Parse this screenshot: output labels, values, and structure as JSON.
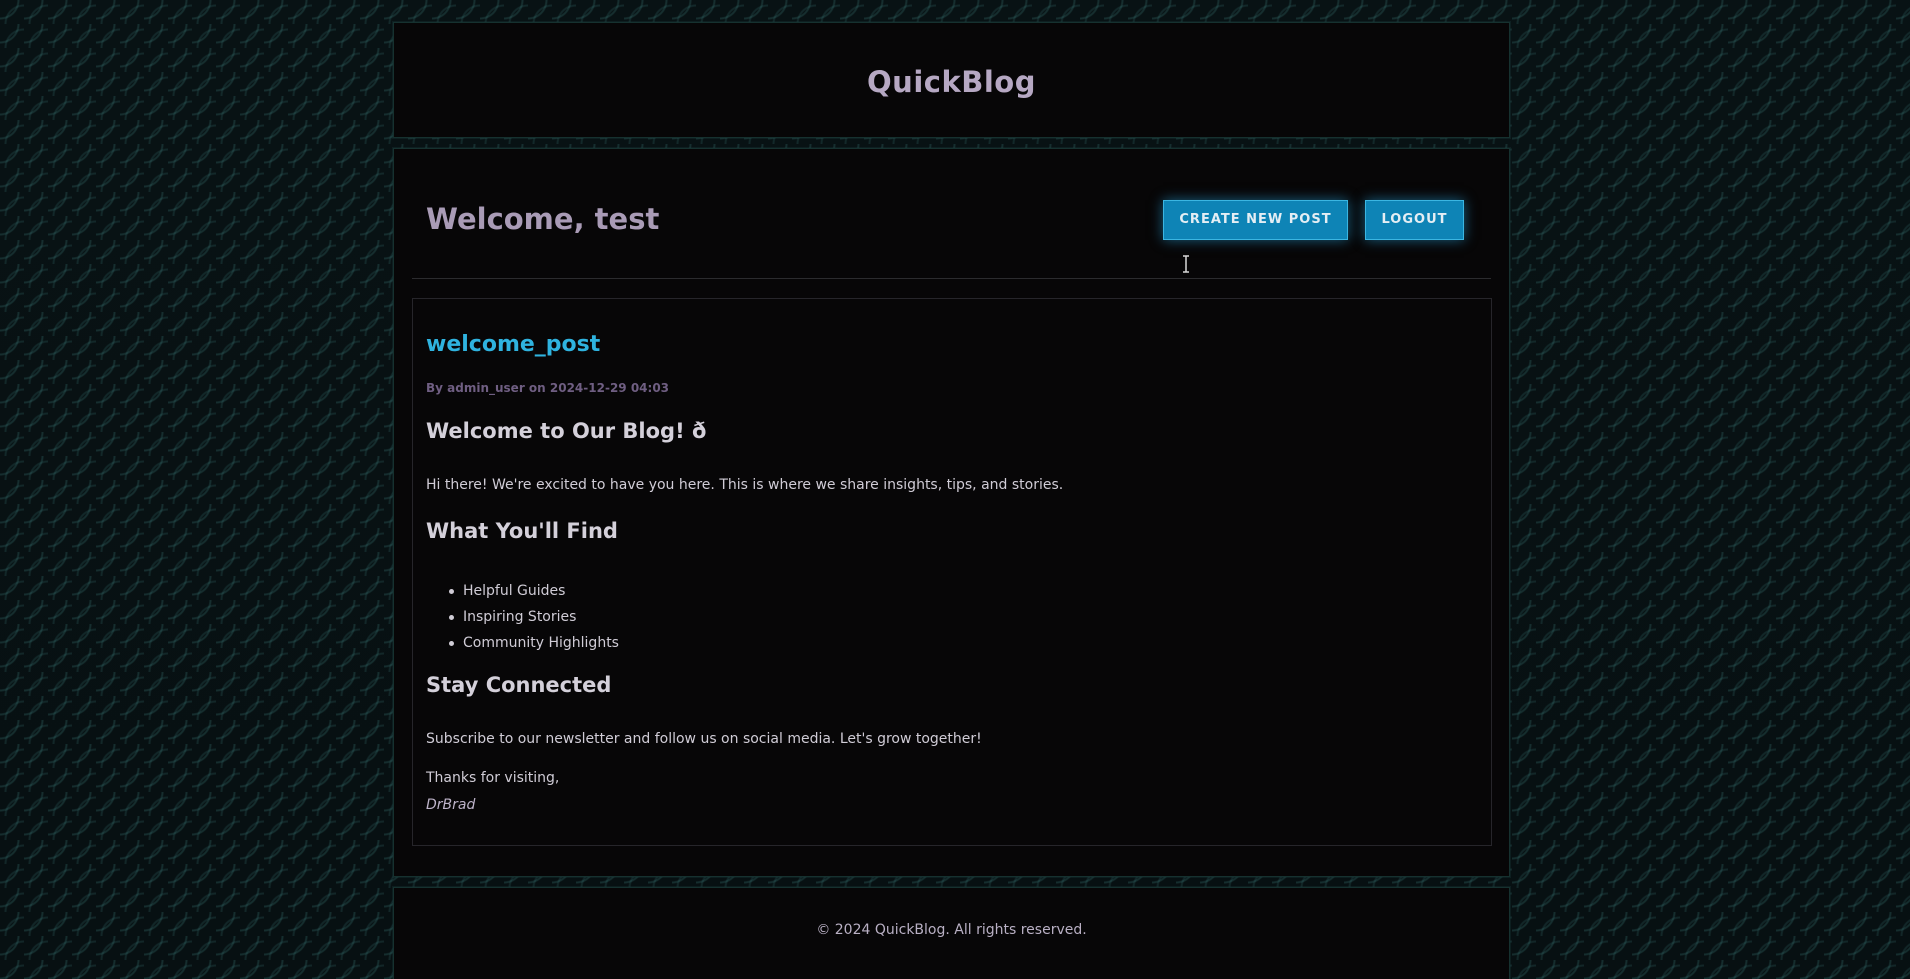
{
  "header": {
    "site_title": "QuickBlog"
  },
  "dashboard": {
    "welcome": "Welcome, test",
    "create_label": "CREATE NEW POST",
    "logout_label": "LOGOUT"
  },
  "post": {
    "title": "welcome_post",
    "meta": "By admin_user on 2024-12-29 04:03",
    "heading1": "Welcome to Our Blog! ð",
    "intro": "Hi there! We're excited to have you here. This is where we share insights, tips, and stories.",
    "heading2": "What You'll Find",
    "items": [
      "Helpful Guides",
      "Inspiring Stories",
      "Community Highlights"
    ],
    "heading3": "Stay Connected",
    "subscribe": "Subscribe to our newsletter and follow us on social media. Let's grow together!",
    "thanks": "Thanks for visiting,",
    "signature": "DrBrad"
  },
  "footer": {
    "text": "© 2024 QuickBlog. All rights reserved."
  },
  "colors": {
    "accent": "#0e84b6",
    "post_title": "#2fb3df",
    "panel_bg": "#070607"
  }
}
